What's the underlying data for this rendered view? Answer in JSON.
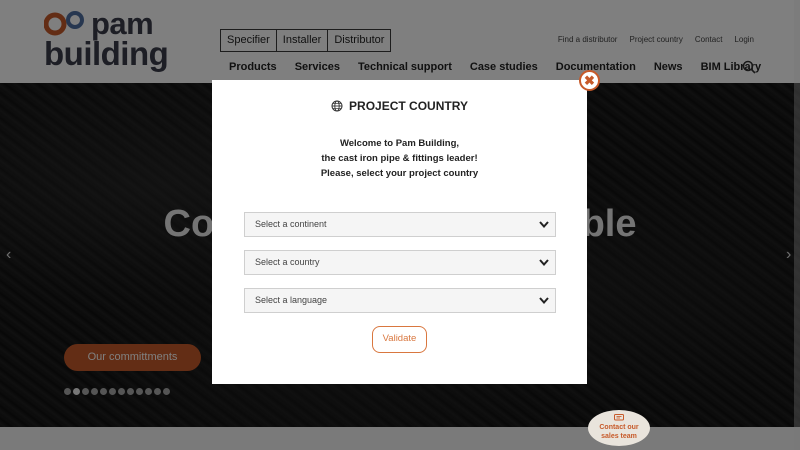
{
  "header": {
    "logo": {
      "word1": "pam",
      "word2": "building"
    },
    "profiles": [
      "Specifier",
      "Installer",
      "Distributor"
    ],
    "utility_links": [
      "Find a distributor",
      "Project country",
      "Contact",
      "Login"
    ],
    "main_nav": [
      "Products",
      "Services",
      "Technical support",
      "Case studies",
      "Documentation",
      "News",
      "BIM Library"
    ],
    "search_icon": "search-icon"
  },
  "hero": {
    "title": "Commitments sustainable",
    "cta_label": "Our committments",
    "slide_count": 12,
    "active_slide": 2,
    "prev_arrow": "‹",
    "next_arrow": "›"
  },
  "contact_bubble": {
    "line1": "Contact our",
    "line2": "sales team"
  },
  "modal": {
    "title": "PROJECT COUNTRY",
    "welcome_lines": [
      "Welcome to Pam Building,",
      "the cast iron pipe & fittings leader!",
      "Please, select your project country"
    ],
    "continent_select": "Select a continent",
    "country_select": "Select a country",
    "language_select": "Select a language",
    "validate_label": "Validate",
    "close_label": "✖"
  },
  "colors": {
    "accent": "#c75a2a",
    "accent_light": "#d9773f",
    "logo_text": "#3a3d4a",
    "logo_blue": "#4e6fa0"
  }
}
